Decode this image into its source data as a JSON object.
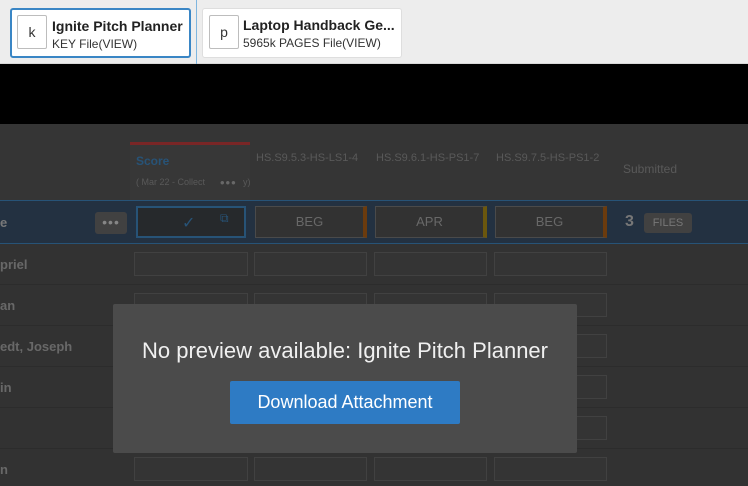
{
  "attachments": [
    {
      "badge": "k",
      "name": "Ignite Pitch Planner",
      "meta": "KEY File(VIEW)"
    },
    {
      "badge": "p",
      "name": "Laptop Handback Ge...",
      "meta": "5965k PAGES File(VIEW)"
    }
  ],
  "grid": {
    "score_header": {
      "title": "Score",
      "subtitle": "( Mar 22 - Collect",
      "subtitle_tail": "y)",
      "menu_icon": "ellipsis-icon"
    },
    "standard_headers": [
      "HS.S9.5.3-HS-LS1-4",
      "HS.S9.6.1-HS-PS1-7",
      "HS.S9.7.5-HS-PS1-2"
    ],
    "submitted_header": "Submitted",
    "class_row": {
      "label": "e",
      "levels": [
        "BEG",
        "APR",
        "BEG"
      ],
      "files_count": "3",
      "files_label": "FILES",
      "level_colors": [
        "#7a4410",
        "#7a6410",
        "#7a4410"
      ]
    },
    "students": [
      "priel",
      "an",
      "edt, Joseph",
      "in",
      "",
      "n"
    ]
  },
  "modal": {
    "message": "No preview available: Ignite Pitch Planner",
    "download_label": "Download Attachment"
  },
  "colors": {
    "accent": "#2e7bc4",
    "active_border": "#3a86c5"
  }
}
